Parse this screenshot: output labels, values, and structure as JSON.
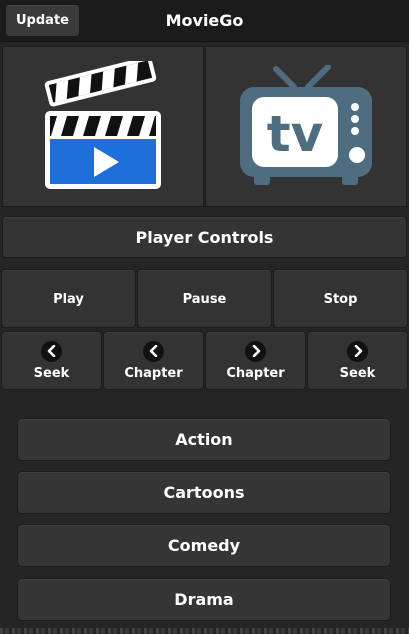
{
  "header": {
    "update_label": "Update",
    "title": "MovieGo"
  },
  "tiles": [
    {
      "name": "movies",
      "icon": "clapperboard-play-icon"
    },
    {
      "name": "tv",
      "icon": "tv-icon",
      "icon_text": "tv"
    }
  ],
  "player_controls": {
    "title": "Player Controls",
    "row1": [
      "Play",
      "Pause",
      "Stop"
    ],
    "row2": [
      {
        "label": "Seek",
        "icon": "chevron-left-icon"
      },
      {
        "label": "Chapter",
        "icon": "chevron-left-icon"
      },
      {
        "label": "Chapter",
        "icon": "chevron-right-icon"
      },
      {
        "label": "Seek",
        "icon": "chevron-right-icon"
      }
    ]
  },
  "genres": [
    "Action",
    "Cartoons",
    "Comedy",
    "Drama"
  ],
  "colors": {
    "background": "#252525",
    "header": "#1b1b1b",
    "button": "#343434",
    "clapper_blue": "#1e6fd9",
    "tv_slate": "#4f6d80"
  }
}
